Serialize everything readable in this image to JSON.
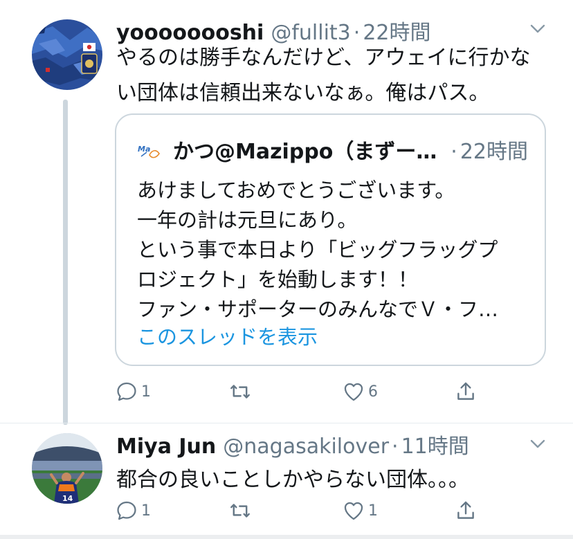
{
  "tweets": [
    {
      "display_name": "yoooooooshi",
      "handle": "@fullit3",
      "dot": "·",
      "time": "22時間",
      "text_lines": [
        "やるのは勝手なんだけど、アウェイに行かな",
        "い団体は信頼出来ないなぁ。俺はパス。"
      ],
      "quote": {
        "display_name": "かつ@Mazippo（まずー…",
        "dot": "·",
        "time": "22時間",
        "text_lines": [
          "あけましておめでとうございます。",
          "一年の計は元旦にあり。",
          "という事で本日より「ビッグフラッグプ",
          "ロジェクト」を始動します！！",
          "ファン・サポーターのみんなでＶ・フ…"
        ],
        "thread_link": "このスレッドを表示"
      },
      "actions": {
        "reply_count": "1",
        "retweet_count": "",
        "like_count": "6",
        "share_count": ""
      }
    },
    {
      "display_name": "Miya Jun",
      "handle": "@nagasakilover",
      "dot": "·",
      "time": "11時間",
      "text_lines": [
        "都合の良いことしかやらない団体。。。"
      ],
      "actions": {
        "reply_count": "1",
        "retweet_count": "",
        "like_count": "1",
        "share_count": ""
      }
    }
  ],
  "icons": {
    "reply": "reply-icon",
    "retweet": "retweet-icon",
    "like": "heart-icon",
    "share": "share-icon",
    "caret": "chevron-down-icon"
  },
  "colors": {
    "text": "#14171a",
    "secondary": "#657786",
    "link": "#1b95e0",
    "border": "#ccd6dd"
  }
}
